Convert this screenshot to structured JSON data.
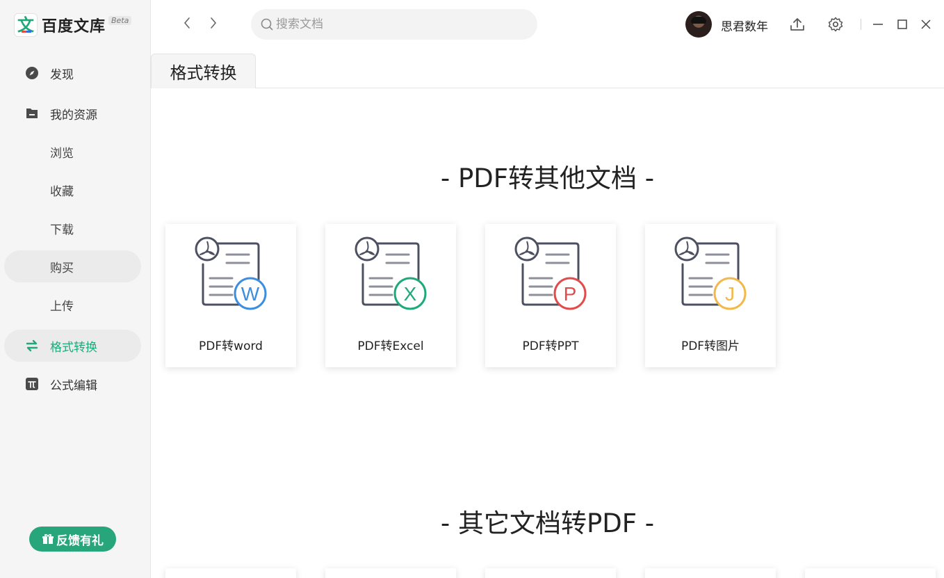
{
  "app": {
    "brand_glyph": "文",
    "name": "百度文库",
    "badge": "Beta"
  },
  "sidebar": {
    "items": [
      {
        "label": "发现",
        "icon": "compass-icon"
      },
      {
        "label": "我的资源",
        "icon": "folder-icon"
      },
      {
        "label": "浏览"
      },
      {
        "label": "收藏"
      },
      {
        "label": "下载"
      },
      {
        "label": "购买"
      },
      {
        "label": "上传"
      },
      {
        "label": "格式转换",
        "icon": "swap-arrows-icon"
      },
      {
        "label": "公式编辑",
        "icon": "pi-icon"
      }
    ],
    "feedback_label": "反馈有礼"
  },
  "topbar": {
    "search_placeholder": "搜索文档",
    "username": "思君数年"
  },
  "tabs": [
    {
      "label": "格式转换"
    }
  ],
  "sections": [
    {
      "title": "- PDF转其他文档 -",
      "cards": [
        {
          "label": "PDF转word",
          "badge_letter": "W",
          "color": "#3b8ee0"
        },
        {
          "label": "PDF转Excel",
          "badge_letter": "X",
          "color": "#1fa97a"
        },
        {
          "label": "PDF转PPT",
          "badge_letter": "P",
          "color": "#e04b4b"
        },
        {
          "label": "PDF转图片",
          "badge_letter": "J",
          "color": "#f2b84b"
        }
      ]
    },
    {
      "title": "- 其它文档转PDF -"
    }
  ],
  "colors": {
    "accent": "#1fa97a",
    "feedback_bg": "#27a57b",
    "sidebar_bg": "#f5f5f5"
  }
}
